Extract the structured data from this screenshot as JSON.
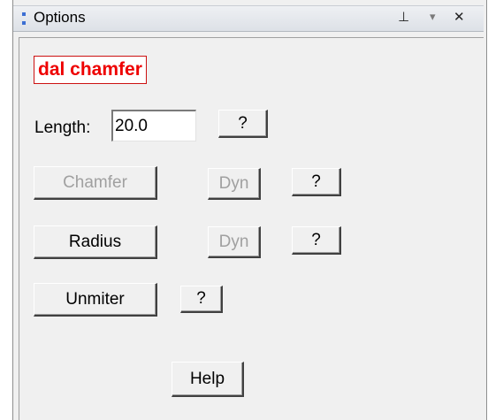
{
  "panel": {
    "title": "Options",
    "pin_glyph": "⊥",
    "dropdown_glyph": "▾",
    "close_glyph": "✕",
    "icons": [
      "grip-icon",
      "pin-icon",
      "dropdown-icon",
      "close-icon"
    ],
    "accent_color": "#3c6fd3"
  },
  "command": {
    "name": "dal chamfer",
    "color": "#ee0000"
  },
  "length": {
    "label": "Length:",
    "value": "20.0",
    "help_label": "?"
  },
  "chamfer": {
    "label": "Chamfer",
    "dyn_label": "Dyn",
    "help_label": "?",
    "enabled": false,
    "dyn_enabled": false
  },
  "radius": {
    "label": "Radius",
    "dyn_label": "Dyn",
    "help_label": "?",
    "enabled": true,
    "dyn_enabled": false
  },
  "unmiter": {
    "label": "Unmiter",
    "help_label": "?"
  },
  "help": {
    "label": "Help"
  }
}
